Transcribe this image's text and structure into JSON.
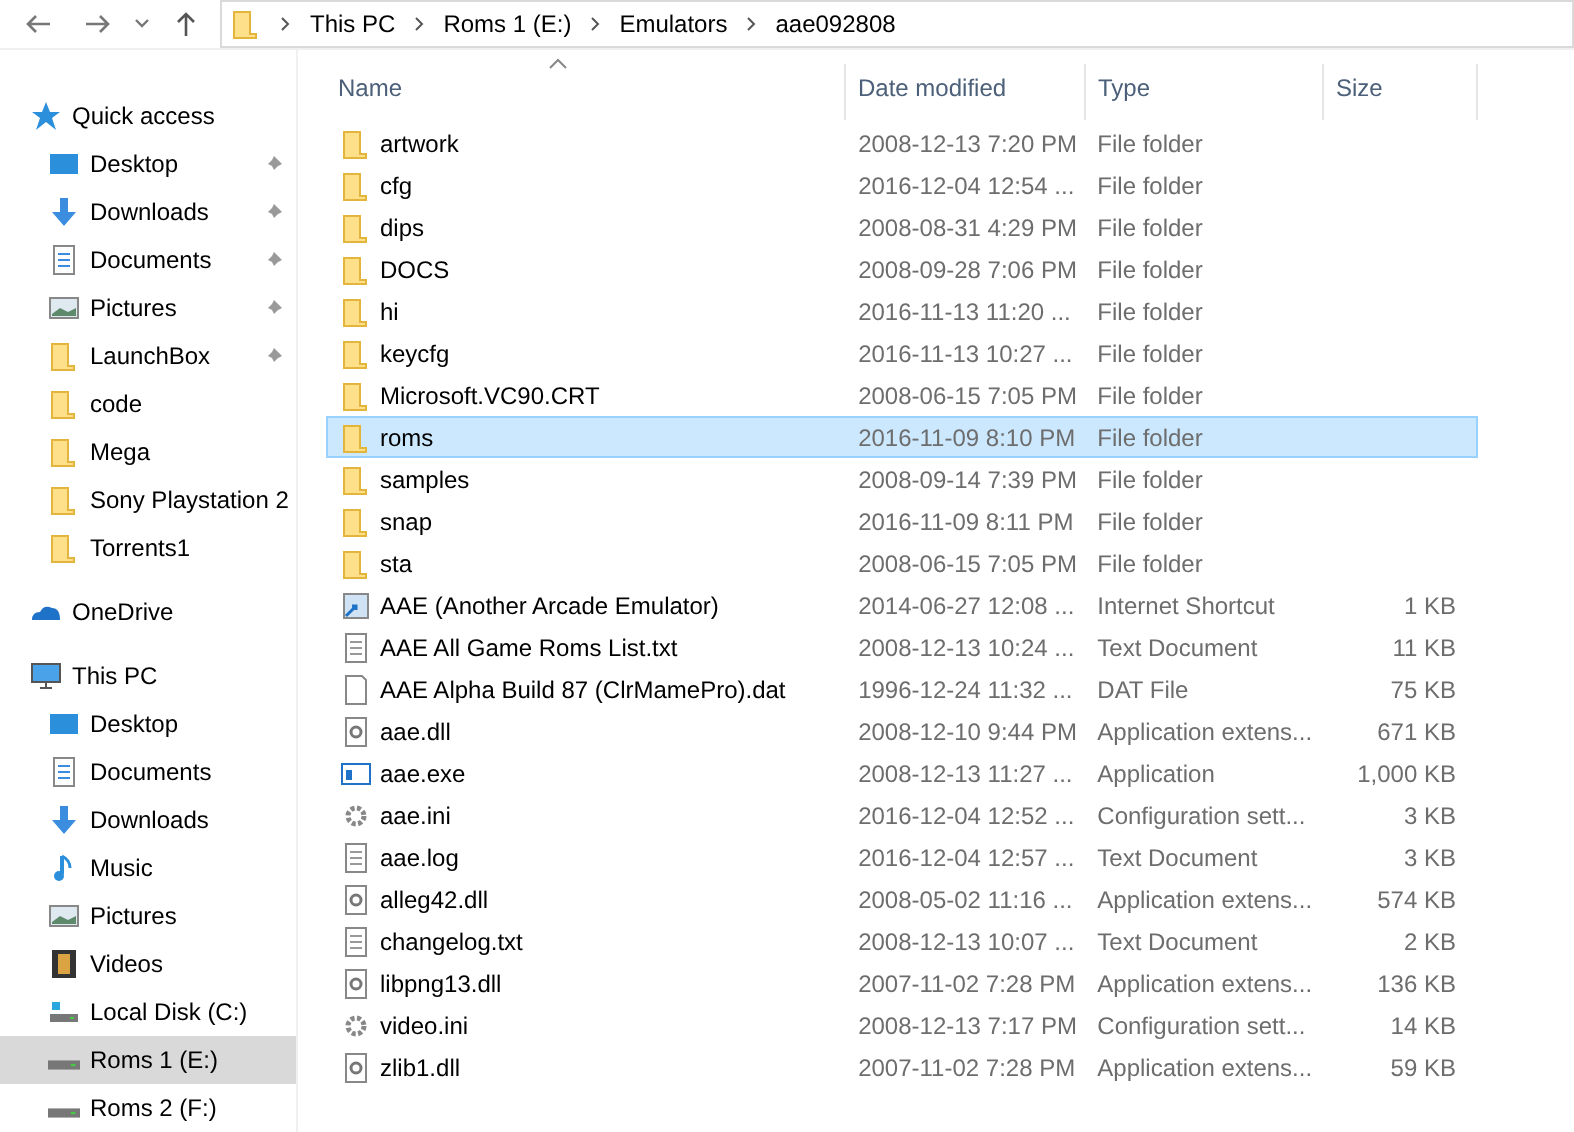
{
  "address_bar": {
    "path": [
      "This PC",
      "Roms 1 (E:)",
      "Emulators",
      "aae092808"
    ]
  },
  "sidebar": {
    "sections": [
      {
        "label": "Quick access",
        "kind": "star",
        "selected": false,
        "children": [
          {
            "label": "Desktop",
            "kind": "desktop",
            "pinned": true,
            "selected": false
          },
          {
            "label": "Downloads",
            "kind": "downloads",
            "pinned": true,
            "selected": false
          },
          {
            "label": "Documents",
            "kind": "documents",
            "pinned": true,
            "selected": false
          },
          {
            "label": "Pictures",
            "kind": "pictures",
            "pinned": true,
            "selected": false
          },
          {
            "label": "LaunchBox",
            "kind": "folder",
            "pinned": true,
            "selected": false
          },
          {
            "label": "code",
            "kind": "folder",
            "pinned": false,
            "selected": false
          },
          {
            "label": "Mega",
            "kind": "folder",
            "pinned": false,
            "selected": false
          },
          {
            "label": "Sony Playstation 2",
            "kind": "folder",
            "pinned": false,
            "selected": false
          },
          {
            "label": "Torrents1",
            "kind": "folder",
            "pinned": false,
            "selected": false
          }
        ]
      },
      {
        "label": "OneDrive",
        "kind": "cloud",
        "selected": false
      },
      {
        "label": "This PC",
        "kind": "pc",
        "selected": false,
        "children": [
          {
            "label": "Desktop",
            "kind": "desktop",
            "pinned": false,
            "selected": false
          },
          {
            "label": "Documents",
            "kind": "documents",
            "pinned": false,
            "selected": false
          },
          {
            "label": "Downloads",
            "kind": "downloads",
            "pinned": false,
            "selected": false
          },
          {
            "label": "Music",
            "kind": "music",
            "pinned": false,
            "selected": false
          },
          {
            "label": "Pictures",
            "kind": "pictures",
            "pinned": false,
            "selected": false
          },
          {
            "label": "Videos",
            "kind": "videos",
            "pinned": false,
            "selected": false
          },
          {
            "label": "Local Disk (C:)",
            "kind": "sysdrive",
            "pinned": false,
            "selected": false
          },
          {
            "label": "Roms 1 (E:)",
            "kind": "drive",
            "pinned": false,
            "selected": true
          },
          {
            "label": "Roms 2 (F:)",
            "kind": "drive",
            "pinned": false,
            "selected": false
          }
        ]
      }
    ]
  },
  "file_list": {
    "columns": [
      "Name",
      "Date modified",
      "Type",
      "Size"
    ],
    "rows": [
      {
        "name": "artwork",
        "date": "2008-12-13 7:20 PM",
        "type": "File folder",
        "size": "",
        "kind": "folder",
        "selected": false
      },
      {
        "name": "cfg",
        "date": "2016-12-04 12:54 ...",
        "type": "File folder",
        "size": "",
        "kind": "folder",
        "selected": false
      },
      {
        "name": "dips",
        "date": "2008-08-31 4:29 PM",
        "type": "File folder",
        "size": "",
        "kind": "folder",
        "selected": false
      },
      {
        "name": "DOCS",
        "date": "2008-09-28 7:06 PM",
        "type": "File folder",
        "size": "",
        "kind": "folder",
        "selected": false
      },
      {
        "name": "hi",
        "date": "2016-11-13 11:20 ...",
        "type": "File folder",
        "size": "",
        "kind": "folder",
        "selected": false
      },
      {
        "name": "keycfg",
        "date": "2016-11-13 10:27 ...",
        "type": "File folder",
        "size": "",
        "kind": "folder",
        "selected": false
      },
      {
        "name": "Microsoft.VC90.CRT",
        "date": "2008-06-15 7:05 PM",
        "type": "File folder",
        "size": "",
        "kind": "folder",
        "selected": false
      },
      {
        "name": "roms",
        "date": "2016-11-09 8:10 PM",
        "type": "File folder",
        "size": "",
        "kind": "folder",
        "selected": true
      },
      {
        "name": "samples",
        "date": "2008-09-14 7:39 PM",
        "type": "File folder",
        "size": "",
        "kind": "folder",
        "selected": false
      },
      {
        "name": "snap",
        "date": "2016-11-09 8:11 PM",
        "type": "File folder",
        "size": "",
        "kind": "folder",
        "selected": false
      },
      {
        "name": "sta",
        "date": "2008-06-15 7:05 PM",
        "type": "File folder",
        "size": "",
        "kind": "folder",
        "selected": false
      },
      {
        "name": "AAE (Another Arcade Emulator)",
        "date": "2014-06-27 12:08 ...",
        "type": "Internet Shortcut",
        "size": "1 KB",
        "kind": "shortcut",
        "selected": false
      },
      {
        "name": "AAE All Game Roms List.txt",
        "date": "2008-12-13 10:24 ...",
        "type": "Text Document",
        "size": "11 KB",
        "kind": "text",
        "selected": false
      },
      {
        "name": "AAE Alpha Build 87 (ClrMamePro).dat",
        "date": "1996-12-24 11:32 ...",
        "type": "DAT File",
        "size": "75 KB",
        "kind": "blank",
        "selected": false
      },
      {
        "name": "aae.dll",
        "date": "2008-12-10 9:44 PM",
        "type": "Application extens...",
        "size": "671 KB",
        "kind": "dll",
        "selected": false
      },
      {
        "name": "aae.exe",
        "date": "2008-12-13 11:27 ...",
        "type": "Application",
        "size": "1,000 KB",
        "kind": "exe",
        "selected": false
      },
      {
        "name": "aae.ini",
        "date": "2016-12-04 12:52 ...",
        "type": "Configuration sett...",
        "size": "3 KB",
        "kind": "ini",
        "selected": false
      },
      {
        "name": "aae.log",
        "date": "2016-12-04 12:57 ...",
        "type": "Text Document",
        "size": "3 KB",
        "kind": "text",
        "selected": false
      },
      {
        "name": "alleg42.dll",
        "date": "2008-05-02 11:16 ...",
        "type": "Application extens...",
        "size": "574 KB",
        "kind": "dll",
        "selected": false
      },
      {
        "name": "changelog.txt",
        "date": "2008-12-13 10:07 ...",
        "type": "Text Document",
        "size": "2 KB",
        "kind": "text",
        "selected": false
      },
      {
        "name": "libpng13.dll",
        "date": "2007-11-02 7:28 PM",
        "type": "Application extens...",
        "size": "136 KB",
        "kind": "dll",
        "selected": false
      },
      {
        "name": "video.ini",
        "date": "2008-12-13 7:17 PM",
        "type": "Configuration sett...",
        "size": "14 KB",
        "kind": "ini",
        "selected": false
      },
      {
        "name": "zlib1.dll",
        "date": "2007-11-02 7:28 PM",
        "type": "Application extens...",
        "size": "59 KB",
        "kind": "dll",
        "selected": false
      }
    ]
  }
}
